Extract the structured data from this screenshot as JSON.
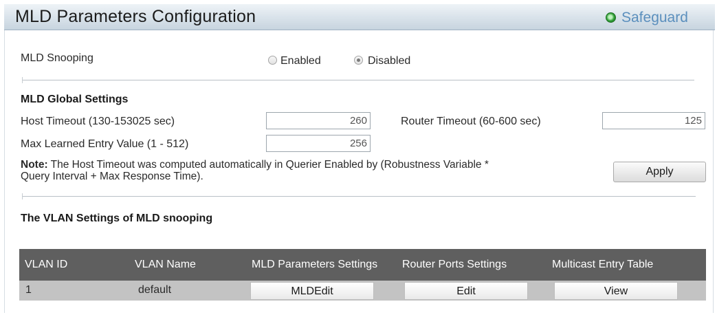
{
  "header": {
    "title": "MLD Parameters Configuration",
    "safeguard_label": "Safeguard"
  },
  "snooping": {
    "label": "MLD Snooping",
    "options": [
      "Enabled",
      "Disabled"
    ],
    "selected": "Disabled"
  },
  "global": {
    "heading": "MLD Global Settings",
    "host_timeout_label": "Host Timeout (130-153025 sec)",
    "host_timeout_value": "260",
    "router_timeout_label": "Router Timeout (60-600 sec)",
    "router_timeout_value": "125",
    "max_learned_label": "Max Learned Entry Value (1 - 512)",
    "max_learned_value": "256",
    "note_prefix": "Note:",
    "note_line1": "The Host Timeout was computed automatically in Querier Enabled by (Robustness Variable *",
    "note_line2": "Query Interval + Max Response Time).",
    "apply_label": "Apply"
  },
  "vlan": {
    "heading": "The VLAN Settings of MLD snooping",
    "columns": [
      "VLAN ID",
      "VLAN Name",
      "MLD Parameters Settings",
      "Router Ports Settings",
      "Multicast Entry Table"
    ],
    "rows": [
      {
        "vlan_id": "1",
        "vlan_name": "default",
        "mld_button": "MLDEdit",
        "router_button": "Edit",
        "multicast_button": "View"
      }
    ]
  }
}
